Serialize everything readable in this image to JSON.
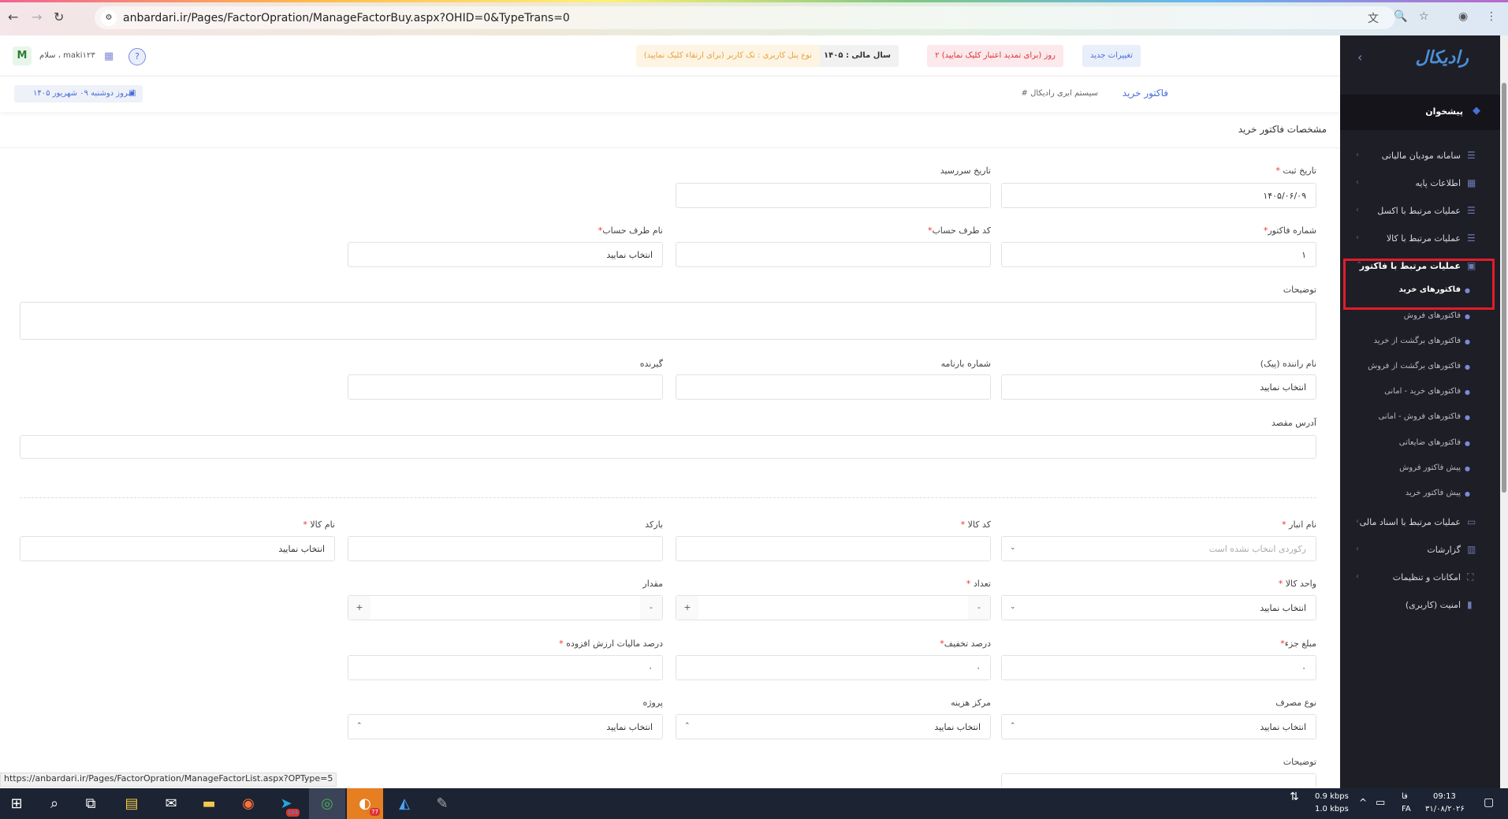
{
  "browser": {
    "url": "anbardari.ir/Pages/FactorOpration/ManageFactorBuy.aspx?OHID=0&TypeTrans=0",
    "status_url": "https://anbardari.ir/Pages/FactorOpration/ManageFactorList.aspx?OPType=5"
  },
  "header": {
    "new_changes": "تغییرات جدید",
    "days_left": "۲ روز (برای تمدید اعتبار کلیک نمایید)",
    "fiscal_year": "سال مالی : ۱۴۰۵",
    "panel_type": "نوع پنل کاربری : تک کاربر (برای ارتقاء کلیک نمایید)",
    "greeting": "سلام ، maki۱۲۳",
    "avatar": "M"
  },
  "breadcrumb": {
    "title": "فاکتور خرید",
    "system": "# سیستم ابری رادیکال",
    "today": "امروز دوشنبه ۰۹ شهریور ۱۴۰۵"
  },
  "card": {
    "title": "مشخصات فاکتور خرید"
  },
  "form": {
    "reg_date_label": "تاریخ ثبت",
    "reg_date_value": "۱۴۰۵/۰۶/۰۹",
    "due_date_label": "تاریخ سررسید",
    "factor_no_label": "شماره فاکتور",
    "factor_no_value": "۱",
    "account_code_label": "کد طرف حساب",
    "account_name_label": "نام طرف حساب",
    "select_placeholder": "انتخاب نمایید",
    "desc_label": "توضیحات",
    "driver_label": "نام راننده (پیک)",
    "waybill_label": "شماره بارنامه",
    "receiver_label": "گیرنده",
    "address_label": "آدرس مقصد",
    "warehouse_label": "نام انبار",
    "warehouse_placeholder": "رکوردی انتخاب نشده است",
    "item_code_label": "کد کالا",
    "barcode_label": "بارکد",
    "item_name_label": "نام کالا",
    "unit_label": "واحد کالا",
    "count_label": "تعداد",
    "amount_label": "مقدار",
    "unit_price_label": "مبلغ جزء",
    "discount_label": "درصد تخفیف",
    "vat_label": "درصد مالیات ارزش افزوده",
    "zero": "۰",
    "usage_label": "نوع مصرف",
    "cost_center_label": "مرکز هزینه",
    "project_label": "پروژه",
    "desc2_label": "توضیحات"
  },
  "sidebar": {
    "logo": "رادیکال",
    "dashboard": "پیشخوان",
    "items": [
      {
        "label": "سامانه مودیان مالیاتی"
      },
      {
        "label": "اطلاعات پایه"
      },
      {
        "label": "عملیات مرتبط با اکسل"
      },
      {
        "label": "عملیات مرتبط با کالا"
      },
      {
        "label": "عملیات مرتبط با فاکتور"
      }
    ],
    "sub_items": [
      {
        "label": "فاکتورهای خرید"
      },
      {
        "label": "فاکتورهای فروش"
      },
      {
        "label": "فاکتورهای برگشت از خرید"
      },
      {
        "label": "فاکتورهای برگشت از فروش"
      },
      {
        "label": "فاکتورهای خرید - امانی"
      },
      {
        "label": "فاکتورهای فروش - امانی"
      },
      {
        "label": "فاکتورهای ضایعاتی"
      },
      {
        "label": "پیش فاکتور فروش"
      },
      {
        "label": "پیش فاکتور خرید"
      }
    ],
    "bottom_items": [
      {
        "label": "عملیات مرتبط با اسناد مالی"
      },
      {
        "label": "گزارشات"
      },
      {
        "label": "امکانات و تنظیمات"
      },
      {
        "label": "امنیت (کاربری)"
      }
    ]
  },
  "taskbar": {
    "net_up": "0.9 kbps",
    "net_down": "1.0 kbps",
    "lang": "FA",
    "lang_top": "فا",
    "time": "09:13",
    "date": "۳۱/۰۸/۲۰۲۶",
    "telegram_badge": "104",
    "app_badge": "77"
  }
}
